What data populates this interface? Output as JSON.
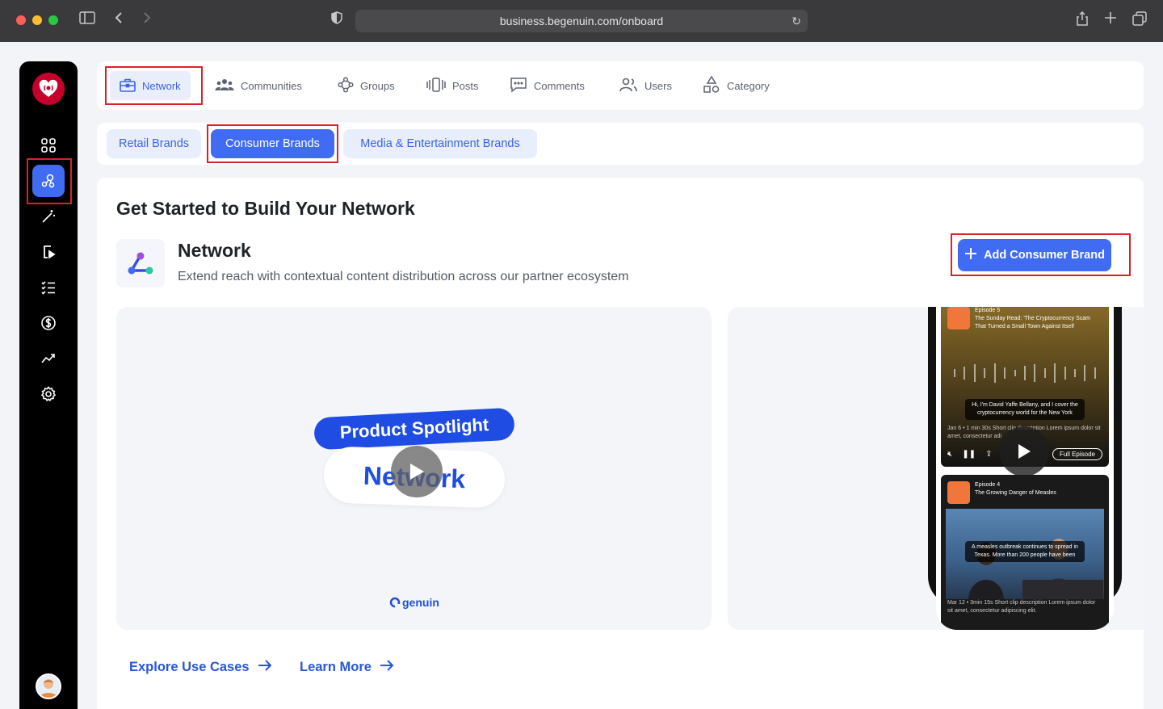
{
  "browser": {
    "url": "business.begenuin.com/onboard"
  },
  "nav": {
    "items": [
      {
        "label": "Network",
        "icon": "briefcase-icon"
      },
      {
        "label": "Communities",
        "icon": "people-icon"
      },
      {
        "label": "Groups",
        "icon": "groups-icon"
      },
      {
        "label": "Posts",
        "icon": "posts-icon"
      },
      {
        "label": "Comments",
        "icon": "comments-icon"
      },
      {
        "label": "Users",
        "icon": "users-icon"
      },
      {
        "label": "Category",
        "icon": "category-icon"
      }
    ]
  },
  "subtabs": [
    {
      "label": "Retail Brands"
    },
    {
      "label": "Consumer Brands"
    },
    {
      "label": "Media & Entertainment Brands"
    }
  ],
  "main": {
    "title": "Get Started to Build Your Network",
    "network_title": "Network",
    "network_desc": "Extend reach with contextual content distribution across our partner ecosystem",
    "add_button": "Add Consumer Brand",
    "video": {
      "pill_text": "Product Spotlight",
      "network_text": "Network",
      "brand": "genuin"
    },
    "phone": {
      "ep1": {
        "label": "Episode 5",
        "title": "The Sunday Read: 'The Cryptocurrency Scam That Turned a Small Town Against Itself",
        "caption": "Hi, I'm David Yaffe Bellany, and I cover the cryptocurrency world for the New York",
        "sub": "Jan 6 • 1 min 30s  Short clip description Lorem ipsum dolor sit amet, consectetur adi",
        "full_episode": "Full Episode"
      },
      "ep2": {
        "label": "Episode 4",
        "title": "The Growing Danger of Measles",
        "caption": "A measles outbreak continues to spread in Texas. More than 200 people have been",
        "sub": "Mar 12 • 3min 15s  Short clip description Lorem ipsum dolor sit amet, consectetur adipiscing elit."
      }
    },
    "links": {
      "explore": "Explore Use Cases",
      "learn": "Learn More"
    }
  },
  "colors": {
    "accent": "#3f6cf3",
    "highlight": "#d8232a",
    "brand_red": "#c6002b"
  }
}
